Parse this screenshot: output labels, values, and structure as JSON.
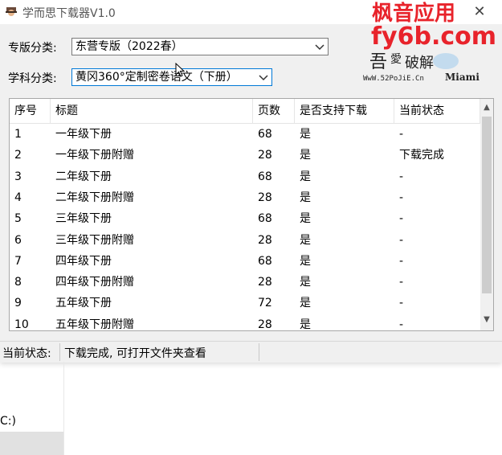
{
  "window": {
    "title": "学而思下载器V1.0",
    "close_glyph": "✕"
  },
  "watermark": {
    "text": "枫音应用",
    "domain": "fy6b.com"
  },
  "form": {
    "edition_label": "专版分类:",
    "edition_value": "东营专版（2022春）",
    "subject_label": "学科分类:",
    "subject_value": "黄冈360°定制密卷语文（下册）"
  },
  "table": {
    "columns": [
      "序号",
      "标题",
      "页数",
      "是否支持下载",
      "当前状态"
    ],
    "rows": [
      [
        "1",
        "一年级下册",
        "68",
        "是",
        "-"
      ],
      [
        "2",
        "一年级下册附赠",
        "28",
        "是",
        "下载完成"
      ],
      [
        "3",
        "二年级下册",
        "68",
        "是",
        "-"
      ],
      [
        "4",
        "二年级下册附赠",
        "28",
        "是",
        "-"
      ],
      [
        "5",
        "三年级下册",
        "68",
        "是",
        "-"
      ],
      [
        "6",
        "三年级下册附赠",
        "28",
        "是",
        "-"
      ],
      [
        "7",
        "四年级下册",
        "68",
        "是",
        "-"
      ],
      [
        "8",
        "四年级下册附赠",
        "28",
        "是",
        "-"
      ],
      [
        "9",
        "五年级下册",
        "72",
        "是",
        "-"
      ],
      [
        "10",
        "五年级下册附赠",
        "28",
        "是",
        "-"
      ]
    ]
  },
  "status": {
    "label": "当前状态:",
    "value": "下载完成, 可打开文件夹查看"
  },
  "background": {
    "fragment_text": "C:)"
  },
  "colors": {
    "watermark_red": "#e8232b",
    "focus_border": "#0078d7",
    "scroll_thumb": "#cdcdcd"
  },
  "icons": {
    "app": "hat-icon",
    "close": "close-icon",
    "caret": "chevron-down-icon",
    "logo": "52pojie-logo"
  }
}
